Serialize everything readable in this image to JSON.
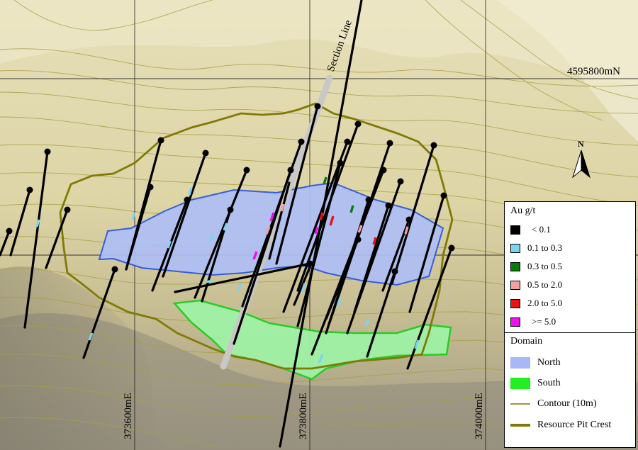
{
  "grid_labels": {
    "northing": "4595800mN",
    "easting_1": "373600mE",
    "easting_2": "373800mE",
    "easting_3": "374000mE"
  },
  "section_line_label": "Section Line",
  "north_arrow_label": "N",
  "legend": {
    "au_title": "Au g/t",
    "au_items": [
      {
        "label": "< 0.1",
        "color": "#000000"
      },
      {
        "label": "0.1 to 0.3",
        "color": "#7fd3ee"
      },
      {
        "label": "0.3 to 0.5",
        "color": "#0a7a0a"
      },
      {
        "label": "0.5 to 2.0",
        "color": "#f4a0a0"
      },
      {
        "label": "2.0 to 5.0",
        "color": "#ee1111"
      },
      {
        "label": ">= 5.0",
        "color": "#ee11ee"
      }
    ],
    "domain_title": "Domain",
    "domain_items": [
      {
        "label": "North",
        "color": "#a8b8f4"
      },
      {
        "label": "South",
        "color": "#22ee22"
      }
    ],
    "contour_label": "Contour (10m)",
    "contour_color": "#9a9a3a",
    "pit_label": "Resource Pit Crest",
    "pit_color": "#7f7a05"
  }
}
